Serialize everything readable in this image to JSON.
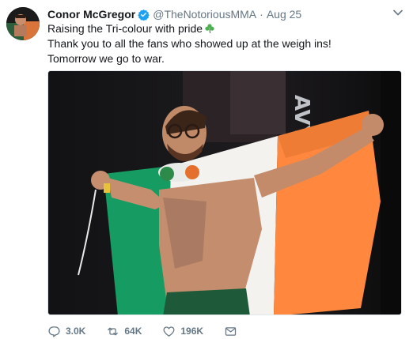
{
  "tweet": {
    "author": {
      "display_name": "Conor McGregor",
      "handle": "@TheNotoriousMMA",
      "verified": true
    },
    "separator": "·",
    "timestamp": "Aug 25",
    "text_lines": [
      "Raising the Tri-colour with pride",
      "Thank you to all the fans who showed up at the weigh ins!",
      "Tomorrow we go to war."
    ],
    "emoji": "shamrock-icon",
    "media": {
      "kind": "photo",
      "banner_text": "AVY"
    },
    "actions": {
      "reply_count": "3.0K",
      "retweet_count": "64K",
      "like_count": "196K"
    }
  },
  "colors": {
    "text": "#14171a",
    "secondary": "#657786",
    "verified": "#1da1f2",
    "flag_green": "#169b62",
    "flag_white": "#ffffff",
    "flag_orange": "#ff883e"
  },
  "icons": [
    "avatar",
    "verified-badge-icon",
    "chevron-down-icon",
    "shamrock-icon",
    "reply-icon",
    "retweet-icon",
    "like-icon",
    "direct-message-icon"
  ]
}
